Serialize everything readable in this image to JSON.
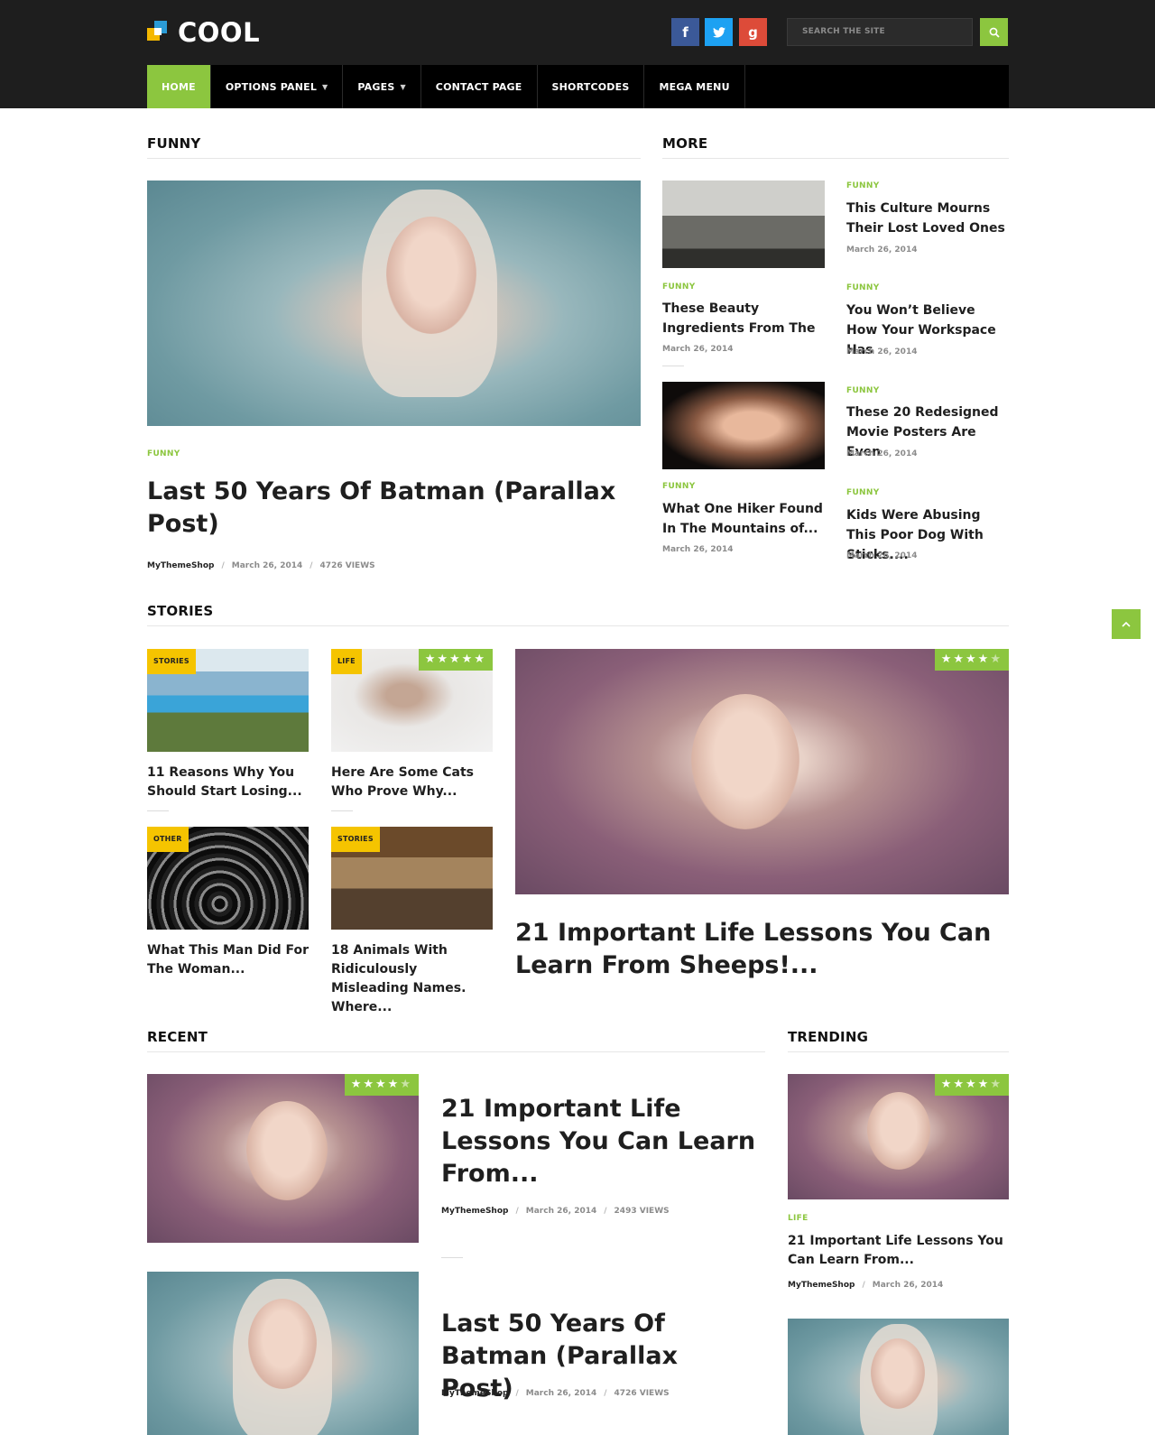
{
  "header": {
    "logo_text": "COOL",
    "social": [
      "facebook-icon",
      "twitter-icon",
      "google-plus-icon"
    ],
    "search_placeholder": "SEARCH THE SITE",
    "nav": [
      {
        "label": "HOME",
        "active": true
      },
      {
        "label": "OPTIONS PANEL",
        "dropdown": true
      },
      {
        "label": "PAGES",
        "dropdown": true
      },
      {
        "label": "CONTACT PAGE"
      },
      {
        "label": "SHORTCODES"
      },
      {
        "label": "MEGA MENU"
      }
    ]
  },
  "colors": {
    "accent": "#8cc63f",
    "tag_yellow": "#f5c400",
    "header_bg": "#1e1e1e",
    "nav_bg": "#000000"
  },
  "funny": {
    "heading": "FUNNY",
    "feature": {
      "category": "FUNNY",
      "title": "Last 50 Years Of Batman (Parallax Post)",
      "author": "MyThemeShop",
      "date": "March 26, 2014",
      "views": "4726 VIEWS"
    }
  },
  "more": {
    "heading": "MORE",
    "left": [
      {
        "category": "FUNNY",
        "title": "These Beauty Ingredients From The",
        "date": "March 26, 2014"
      },
      {
        "category": "FUNNY",
        "title": "What One Hiker Found In The Mountains of...",
        "date": "March 26, 2014"
      }
    ],
    "right": [
      {
        "category": "FUNNY",
        "title": "This Culture Mourns Their Lost Loved Ones",
        "date": "March 26, 2014"
      },
      {
        "category": "FUNNY",
        "title": "You Won’t Believe How Your Workspace Has",
        "date": "March 26, 2014"
      },
      {
        "category": "FUNNY",
        "title": "These 20 Redesigned Movie Posters Are Even",
        "date": "March 26, 2014"
      },
      {
        "category": "FUNNY",
        "title": "Kids Were Abusing This Poor Dog With Sticks....",
        "date": "March 26, 2014"
      }
    ]
  },
  "stories": {
    "heading": "STORIES",
    "grid": [
      {
        "tag": "STORIES",
        "title": "11 Reasons Why You Should Start Losing..."
      },
      {
        "tag": "LIFE",
        "title": "Here Are Some Cats Who Prove Why...",
        "rating": 5
      },
      {
        "tag": "OTHER",
        "title": "What This Man Did For The Woman..."
      },
      {
        "tag": "STORIES",
        "title": "18 Animals With Ridiculously Misleading Names. Where..."
      }
    ],
    "feature": {
      "title": "21 Important Life Lessons You Can Learn From Sheeps!...",
      "rating": 4
    }
  },
  "recent": {
    "heading": "RECENT",
    "items": [
      {
        "title": "21 Important Life Lessons You Can Learn From...",
        "author": "MyThemeShop",
        "date": "March 26, 2014",
        "views": "2493 VIEWS",
        "rating": 4
      },
      {
        "title": "Last 50 Years Of Batman (Parallax Post)",
        "author": "MyThemeShop",
        "date": "March 26, 2014",
        "views": "4726 VIEWS"
      }
    ]
  },
  "trending": {
    "heading": "TRENDING",
    "items": [
      {
        "category": "LIFE",
        "title": "21 Important Life Lessons You Can Learn From...",
        "author": "MyThemeShop",
        "date": "March 26, 2014",
        "rating": 4
      }
    ]
  }
}
